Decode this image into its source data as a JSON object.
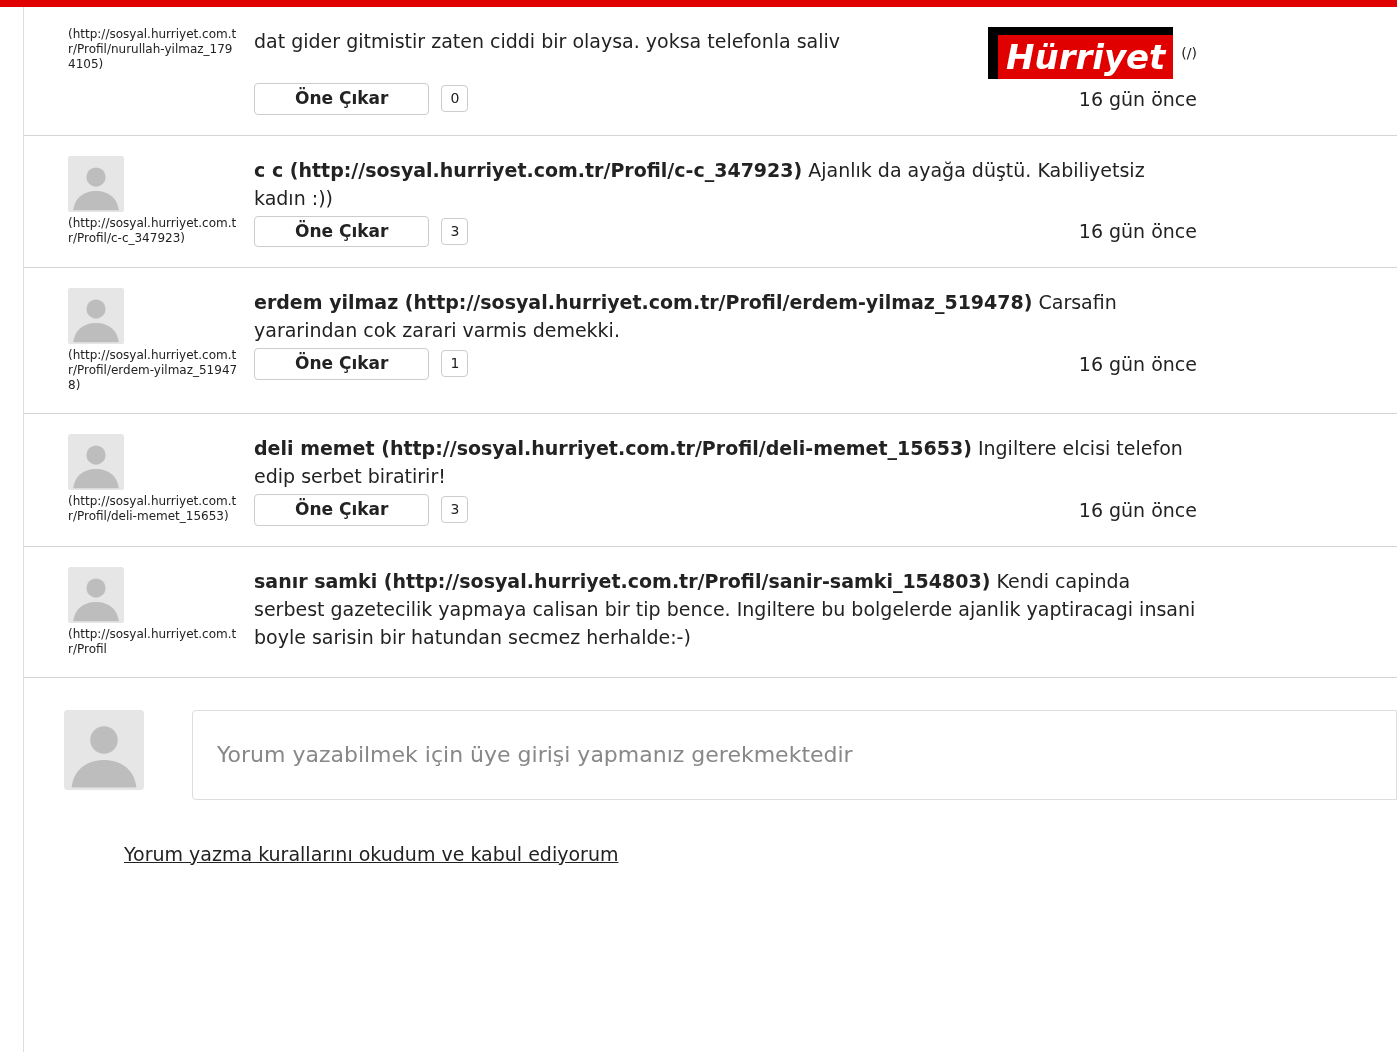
{
  "logo": {
    "text": "Hürriyet",
    "mark": "(/)"
  },
  "comments": [
    {
      "text": "dat gider gitmistir zaten ciddi bir olaysa. yoksa telefonla saliv",
      "profile_link": "(http://sosyal.hurriyet.com.tr/Profil/nurullah-yilmaz_1794105)",
      "has_avatar": false,
      "feature_button": "Öne Çıkar",
      "count": "0",
      "time": "16 gün önce"
    },
    {
      "text": "**c c (http://sosyal.hurriyet.com.tr/Profil/c-c_347923)** Ajanlık da ayağa düştü. Kabiliyetsiz kadın :))",
      "profile_link": "(http://sosyal.hurriyet.com.tr/Profil/c-c_347923)",
      "has_avatar": true,
      "feature_button": "Öne Çıkar",
      "count": "3",
      "time": "16 gün önce"
    },
    {
      "text": "**erdem yilmaz (http://sosyal.hurriyet.com.tr/Profil/erdem-yilmaz_519478)** Carsafin yararindan cok zarari varmis demekki.",
      "profile_link": "(http://sosyal.hurriyet.com.tr/Profil/erdem-yilmaz_519478)",
      "has_avatar": true,
      "feature_button": "Öne Çıkar",
      "count": "1",
      "time": "16 gün önce"
    },
    {
      "text": "**deli memet (http://sosyal.hurriyet.com.tr/Profil/deli-memet_15653)** Ingiltere elcisi telefon edip serbet biratirir!",
      "profile_link": "(http://sosyal.hurriyet.com.tr/Profil/deli-memet_15653)",
      "has_avatar": true,
      "feature_button": "Öne Çıkar",
      "count": "3",
      "time": "16 gün önce"
    },
    {
      "text": "**sanır samki (http://sosyal.hurriyet.com.tr/Profil/sanir-samki_154803)** Kendi capinda serbest gazetecilik yapmaya calisan bir tip bence. Ingiltere bu bolgelerde ajanlik yaptiracagi insani boyle sarisin bir hatundan secmez herhalde:-)",
      "profile_link": "(http://sosyal.hurriyet.com.tr/Profil",
      "has_avatar": true
    }
  ],
  "comment_form": {
    "placeholder": "Yorum yazabilmek için üye girişi yapmanız gerekmektedir"
  },
  "rules_link": "Yorum yazma kurallarını okudum ve kabul ediyorum"
}
